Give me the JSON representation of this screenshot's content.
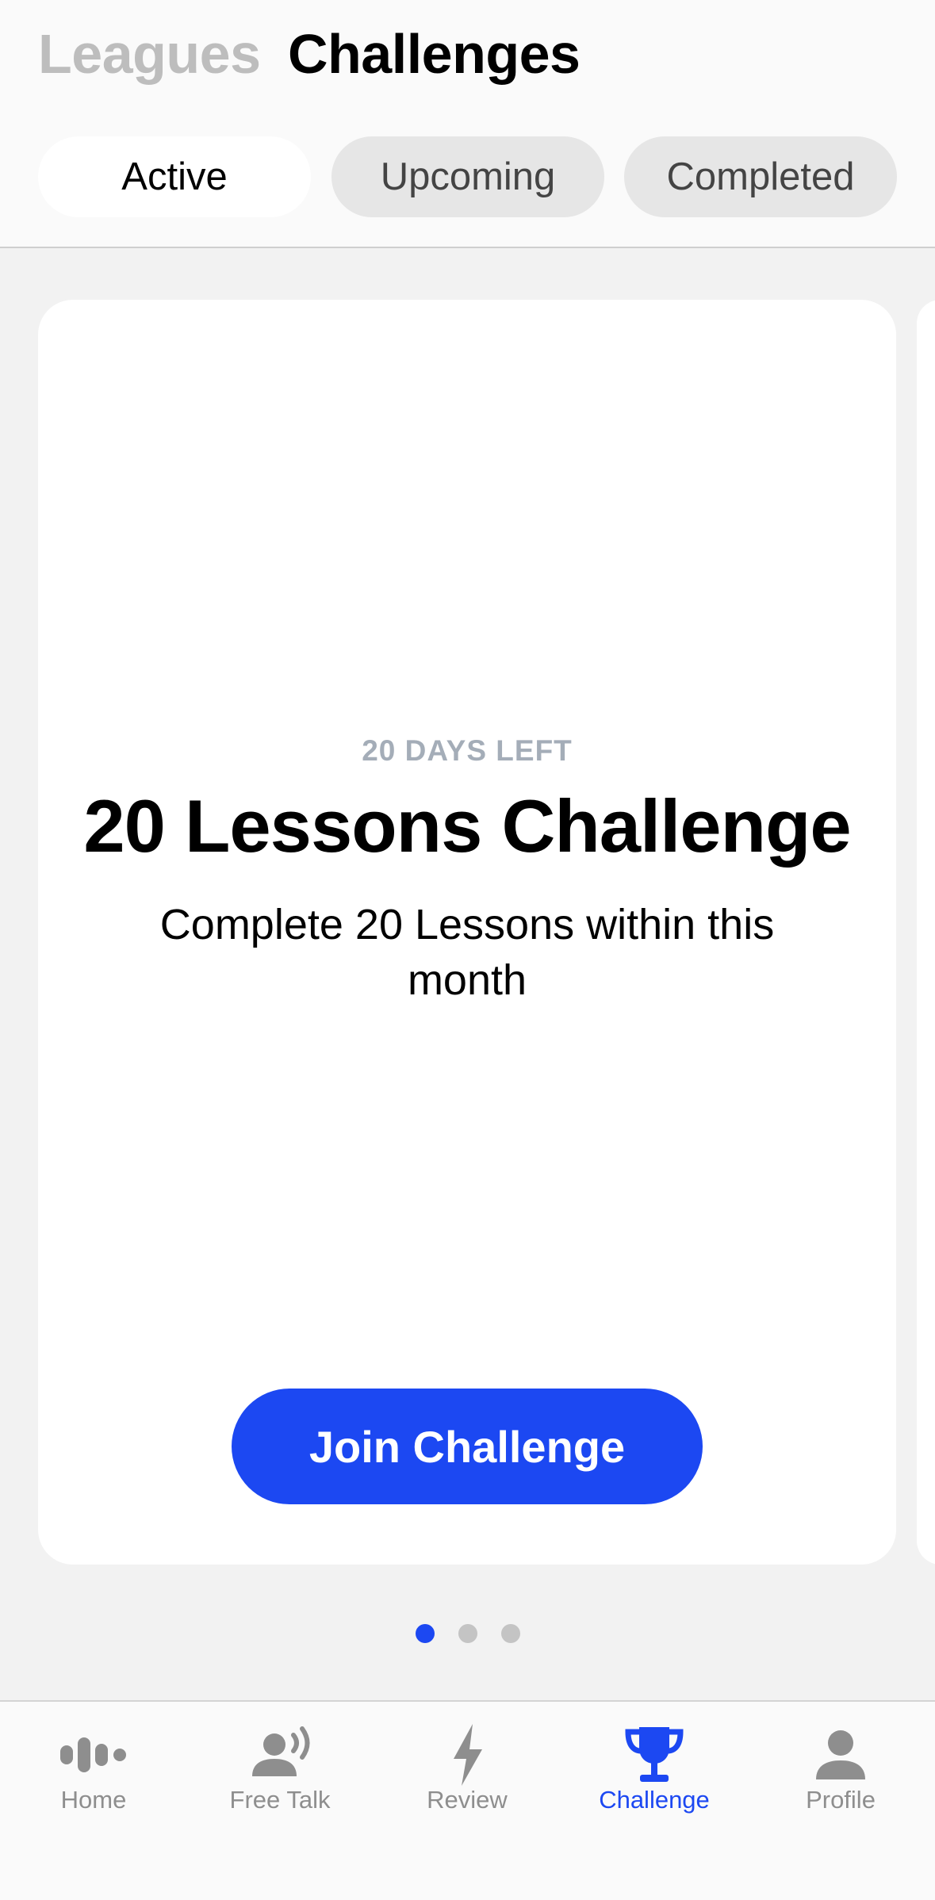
{
  "header": {
    "tabs": [
      {
        "label": "Leagues",
        "selected": false
      },
      {
        "label": "Challenges",
        "selected": true
      }
    ]
  },
  "filters": {
    "active": "Active",
    "upcoming": "Upcoming",
    "completed": "Completed",
    "selected": "Active"
  },
  "challenge_card": {
    "days_left": "20 DAYS LEFT",
    "title": "20 Lessons Challenge",
    "description": "Complete 20 Lessons within this month",
    "button_label": "Join Challenge"
  },
  "pagination": {
    "total": 3,
    "current": 1
  },
  "tab_bar": {
    "items": [
      {
        "label": "Home",
        "icon": "waveform-icon"
      },
      {
        "label": "Free Talk",
        "icon": "person-speaking-icon"
      },
      {
        "label": "Review",
        "icon": "lightning-bolt-icon"
      },
      {
        "label": "Challenge",
        "icon": "trophy-icon"
      },
      {
        "label": "Profile",
        "icon": "person-icon"
      }
    ],
    "selected": "Challenge"
  },
  "colors": {
    "accent": "#1c48f2",
    "inactive_text": "#8e8e8e",
    "muted_heading": "#bdbdbd",
    "days_left": "#a4adb8"
  }
}
